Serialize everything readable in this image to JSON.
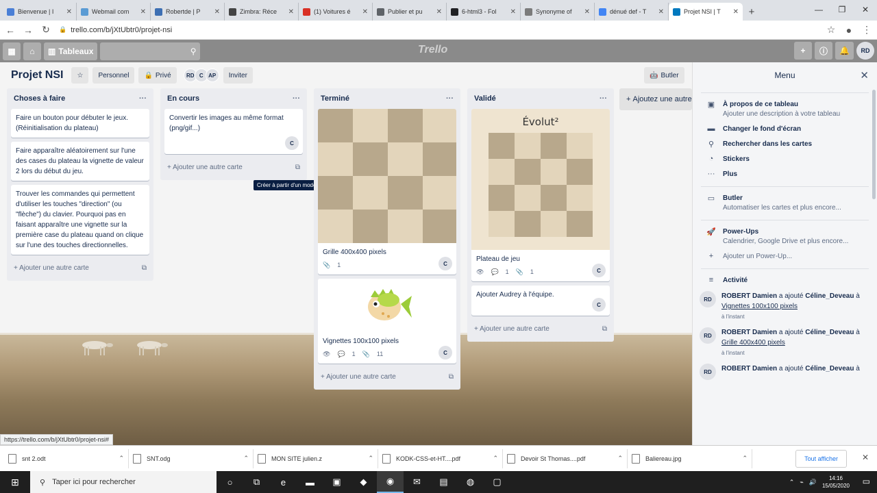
{
  "browser": {
    "tabs": [
      {
        "title": "Bienvenue | I",
        "color": "#4a7fd6"
      },
      {
        "title": "Webmail com",
        "color": "#5a9bd4"
      },
      {
        "title": "Robertde | P",
        "color": "#3d6fb3"
      },
      {
        "title": "Zimbra: Réce",
        "color": "#444444"
      },
      {
        "title": "(1) Voitures é",
        "color": "#d93025"
      },
      {
        "title": "Publier et pu",
        "color": "#5f6368"
      },
      {
        "title": "6-html3 - Fol",
        "color": "#202124"
      },
      {
        "title": "Synonyme of",
        "color": "#7b7b7b"
      },
      {
        "title": "dénué def - T",
        "color": "#4285f4"
      },
      {
        "title": "Projet NSI | T",
        "color": "#0079bf"
      }
    ],
    "url": "trello.com/b/jXtUbtr0/projet-nsi",
    "status_url": "https://trello.com/b/jXtUbtr0/projet-nsi#"
  },
  "trello": {
    "boards_label": "Tableaux",
    "logo": "Trello",
    "user_initials": "RD"
  },
  "board": {
    "title": "Projet NSI",
    "visibility_team": "Personnel",
    "visibility": "Privé",
    "members": [
      "RD",
      "C",
      "AP"
    ],
    "invite_label": "Inviter",
    "butler_label": "Butler",
    "add_list_label": "Ajoutez une autre liste",
    "tooltip": "Créer à partir d'un modèle..."
  },
  "lists": [
    {
      "title": "Choses à faire",
      "cards": [
        "Faire un bouton pour débuter le jeux. (Réinitialisation du plateau)",
        "Faire apparaître aléatoirement sur l'une des cases du plateau la vignette de valeur 2 lors du début du jeu.",
        "Trouver les commandes qui permettent d'utiliser les touches \"direction\" (ou \"flèche\") du clavier. Pourquoi pas en faisant apparaître une vignette sur la première case du plateau quand on clique sur l'une des touches directionnelles."
      ],
      "add_label": "Ajouter une autre carte"
    },
    {
      "title": "En cours",
      "cards": [
        "Convertir les images au même format (png/gif...)"
      ],
      "card_member": "C",
      "add_label": "Ajouter une autre carte"
    },
    {
      "title": "Terminé",
      "card1": {
        "title": "Grille 400x400 pixels",
        "attachments": "1",
        "member": "C"
      },
      "card2": {
        "title": "Vignettes 100x100 pixels",
        "comments": "1",
        "attachments": "11",
        "member": "C"
      },
      "add_label": "Ajouter une autre carte"
    },
    {
      "title": "Validé",
      "card1": {
        "cover_title": "Évolut²",
        "title": "Plateau de jeu",
        "comments": "1",
        "attachments": "1",
        "member": "C"
      },
      "card2": {
        "title": "Ajouter Audrey à l'équipe.",
        "member": "C"
      },
      "add_label": "Ajouter une autre carte"
    }
  ],
  "menu": {
    "title": "Menu",
    "items": [
      {
        "icon": "board-icon",
        "title": "À propos de ce tableau",
        "sub": "Ajouter une description à votre tableau"
      },
      {
        "icon": "background-icon",
        "title": "Changer le fond d'écran",
        "sub": ""
      },
      {
        "icon": "search-icon",
        "title": "Rechercher dans les cartes",
        "sub": ""
      },
      {
        "icon": "sticker-icon",
        "title": "Stickers",
        "sub": ""
      },
      {
        "icon": "more-icon",
        "title": "Plus",
        "sub": ""
      }
    ],
    "butler": {
      "title": "Butler",
      "sub": "Automatiser les cartes et plus encore..."
    },
    "powerups": {
      "title": "Power-Ups",
      "sub": "Calendrier, Google Drive et plus encore...",
      "add": "Ajouter un Power-Up..."
    },
    "activity_title": "Activité",
    "activities": [
      {
        "who": "ROBERT Damien",
        "verb": "a ajouté",
        "target": "Céline_Deveau",
        "to": "à",
        "card": "Vignettes 100x100 pixels",
        "time": "à l'instant"
      },
      {
        "who": "ROBERT Damien",
        "verb": "a ajouté",
        "target": "Céline_Deveau",
        "to": "à",
        "card": "Grille 400x400 pixels",
        "time": "à l'instant"
      },
      {
        "who": "ROBERT Damien",
        "verb": "a ajouté",
        "target": "Céline_Deveau",
        "to": "à",
        "card": "",
        "time": ""
      }
    ]
  },
  "downloads": {
    "items": [
      "snt 2.odt",
      "SNT.odg",
      "MON SITE julien.z",
      "KODK-CSS-et-HT....pdf",
      "Devoir St Thomas....pdf",
      "Baliereau.jpg"
    ],
    "show_all": "Tout afficher"
  },
  "taskbar": {
    "search_placeholder": "Taper ici pour rechercher",
    "time": "14:16",
    "date": "15/05/2020"
  }
}
